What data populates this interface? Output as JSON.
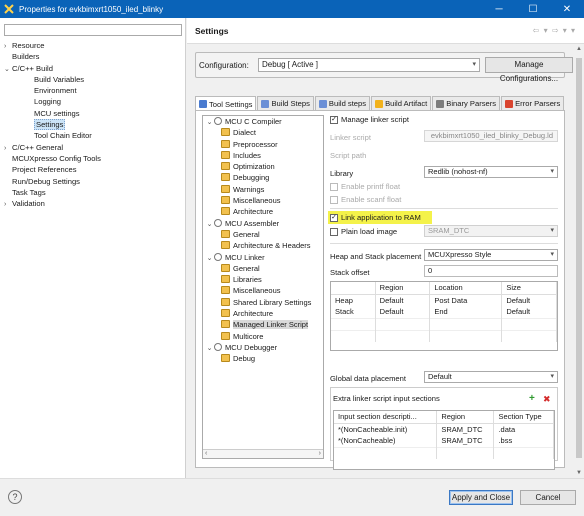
{
  "window": {
    "title": "Properties for evkbimxrt1050_iled_blinky",
    "minimize": "─",
    "maximize": "☐",
    "close": "✕"
  },
  "left_tree": {
    "filter_value": "",
    "items": [
      {
        "label": "Resource",
        "toggle": "›",
        "indent": 0
      },
      {
        "label": "Builders",
        "toggle": "",
        "indent": 0
      },
      {
        "label": "C/C++ Build",
        "toggle": "⌄",
        "indent": 0
      },
      {
        "label": "Build Variables",
        "toggle": "",
        "indent": 1
      },
      {
        "label": "Environment",
        "toggle": "",
        "indent": 1
      },
      {
        "label": "Logging",
        "toggle": "",
        "indent": 1
      },
      {
        "label": "MCU settings",
        "toggle": "",
        "indent": 1
      },
      {
        "label": "Settings",
        "toggle": "",
        "indent": 1,
        "selected": true
      },
      {
        "label": "Tool Chain Editor",
        "toggle": "",
        "indent": 1
      },
      {
        "label": "C/C++ General",
        "toggle": "›",
        "indent": 0
      },
      {
        "label": "MCUXpresso Config Tools",
        "toggle": "",
        "indent": 0
      },
      {
        "label": "Project References",
        "toggle": "",
        "indent": 0
      },
      {
        "label": "Run/Debug Settings",
        "toggle": "",
        "indent": 0
      },
      {
        "label": "Task Tags",
        "toggle": "",
        "indent": 0
      },
      {
        "label": "Validation",
        "toggle": "›",
        "indent": 0
      }
    ]
  },
  "settings": {
    "title": "Settings",
    "nav": "⇦ ▾ ⇨ ▾ ▾",
    "config_label": "Configuration:",
    "config_value": "Debug  [ Active ]",
    "manage_configs": "Manage Configurations...",
    "tabs": [
      {
        "label": "Tool Settings",
        "color": "#4a7bd0",
        "active": true
      },
      {
        "label": "Build Steps",
        "color": "#6b8fd6"
      },
      {
        "label": "Build steps",
        "color": "#6b8fd6"
      },
      {
        "label": "Build Artifact",
        "color": "#f2b21c"
      },
      {
        "label": "Binary Parsers",
        "color": "#7c7c7c"
      },
      {
        "label": "Error Parsers",
        "color": "#d9442f"
      }
    ]
  },
  "tool_tree": [
    {
      "label": "MCU C Compiler",
      "toggle": "⌄",
      "group": true
    },
    {
      "label": "Dialect"
    },
    {
      "label": "Preprocessor"
    },
    {
      "label": "Includes"
    },
    {
      "label": "Optimization"
    },
    {
      "label": "Debugging"
    },
    {
      "label": "Warnings"
    },
    {
      "label": "Miscellaneous"
    },
    {
      "label": "Architecture"
    },
    {
      "label": "MCU Assembler",
      "toggle": "⌄",
      "group": true
    },
    {
      "label": "General"
    },
    {
      "label": "Architecture & Headers"
    },
    {
      "label": "MCU Linker",
      "toggle": "⌄",
      "group": true
    },
    {
      "label": "General"
    },
    {
      "label": "Libraries"
    },
    {
      "label": "Miscellaneous"
    },
    {
      "label": "Shared Library Settings"
    },
    {
      "label": "Architecture"
    },
    {
      "label": "Managed Linker Script",
      "selected": true
    },
    {
      "label": "Multicore"
    },
    {
      "label": "MCU Debugger",
      "toggle": "⌄",
      "group": true
    },
    {
      "label": "Debug"
    }
  ],
  "linker": {
    "manage_linker_script": "Manage linker script",
    "linker_script_label": "Linker script",
    "linker_script_value": "evkbimxrt1050_iled_blinky_Debug.ld",
    "script_path_label": "Script path",
    "library_label": "Library",
    "library_value": "Redlib (nohost-nf)",
    "enable_printf": "Enable printf float",
    "enable_scanf": "Enable scanf float",
    "link_to_ram": "Link application to RAM",
    "plain_load_image": "Plain load image",
    "plain_load_value": "SRAM_DTC",
    "heap_stack_label": "Heap and Stack placement",
    "heap_stack_value": "MCUXpresso Style",
    "stack_offset_label": "Stack offset",
    "stack_offset_value": "0",
    "hs_columns": [
      "",
      "Region",
      "Location",
      "Size"
    ],
    "hs_rows": [
      [
        "Heap",
        "Default",
        "Post Data",
        "Default"
      ],
      [
        "Stack",
        "Default",
        "End",
        "Default"
      ]
    ],
    "global_placement_label": "Global data placement",
    "global_placement_value": "Default",
    "extra_sections_label": "Extra linker script input sections",
    "add_icon": "+",
    "remove_icon": "✖",
    "es_columns": [
      "Input section descripti...",
      "Region",
      "Section Type"
    ],
    "es_rows": [
      [
        "*(NonCacheable.init)",
        "SRAM_DTC",
        ".data"
      ],
      [
        "*(NonCacheable)",
        "SRAM_DTC",
        ".bss"
      ]
    ]
  },
  "footer": {
    "help": "?",
    "apply_close": "Apply and Close",
    "cancel": "Cancel"
  }
}
